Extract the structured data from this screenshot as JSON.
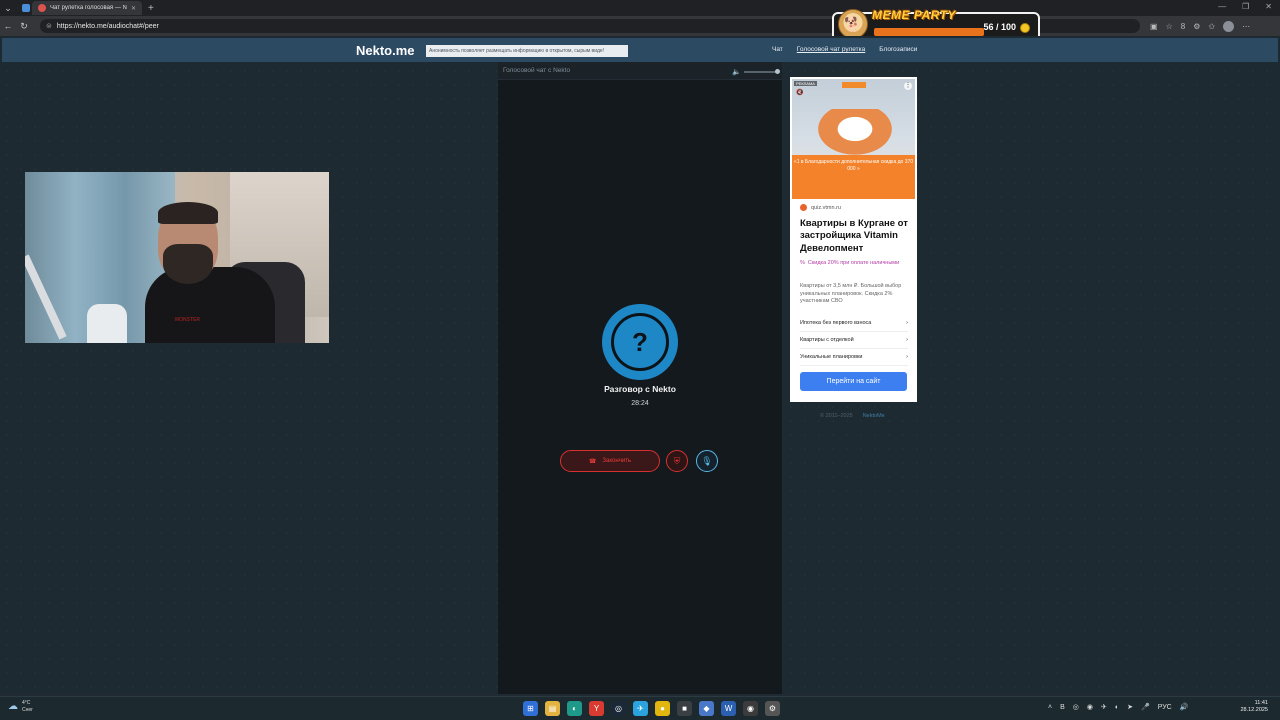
{
  "browser": {
    "tab_title": "Чат рулетка голосовая — N",
    "tab_close": "✕",
    "new_tab": "+",
    "url": "https://nekto.me/audiochat#/peer",
    "window_controls": [
      "—",
      "❐",
      "✕"
    ],
    "ext_count": "8"
  },
  "overlay": {
    "title": "MEME PARTY",
    "count": "56 / 100"
  },
  "site": {
    "logo": "Nekto.me",
    "anon_note": "Анонимность позволяет размещать информацию в открытом, сырым виде!",
    "nav": [
      {
        "label": "Чат"
      },
      {
        "label": "Голосовой чат рулетка"
      },
      {
        "label": "Блогозаписи"
      }
    ]
  },
  "webcam": {
    "shirt_text": "MONSTER"
  },
  "chat": {
    "header": "Голосовой чат с Nekto",
    "avatar_symbol": "?",
    "title": "Разговор с Nekto",
    "timer": "28:24",
    "end_label": "Закончить"
  },
  "ad": {
    "label": "РЕКЛАМА",
    "strip_text": "«1 в Благодарности дополнительная скидка до 370 000 »",
    "domain": "quiz.vtmn.ru",
    "headline": "Квартиры в Кургане от застройщика Vitamin Девелопмент",
    "discount": "Скидка 20% при оплате наличными",
    "description": "Квартиры от 3,5 млн ₽. Большой выбор уникальных планировок. Скидка 2% участникам СВО",
    "links": [
      {
        "label": "Ипотека без первого взноса"
      },
      {
        "label": "Квартиры с отделкой"
      },
      {
        "label": "Уникальные планировки"
      }
    ],
    "cta": "Перейти на сайт"
  },
  "footer": {
    "copyright": "© 2011–2025",
    "link": "NektoMe"
  },
  "taskbar": {
    "temperature": "4°C",
    "weather": "Снег",
    "lang": "РУС",
    "time": "11:41",
    "date": "28.12.2025"
  },
  "colors": {
    "accent_blue": "#1e88c7",
    "end_red": "#d6312f",
    "header_blue": "#2d4a63",
    "ad_cta": "#3d7ef0"
  }
}
